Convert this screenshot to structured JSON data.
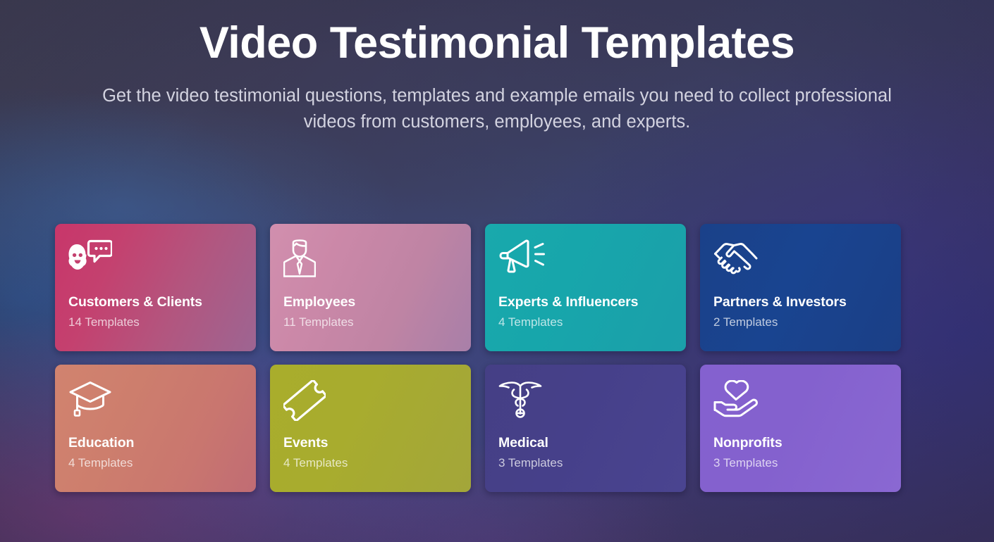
{
  "header": {
    "title": "Video Testimonial Templates",
    "subtitle": "Get the video testimonial questions, templates and example emails you need to collect professional videos from customers, employees, and experts."
  },
  "cards": [
    {
      "id": "customers-clients",
      "title": "Customers & Clients",
      "count": "14 Templates",
      "icon": "face-speech-bubble-icon",
      "gradient": "linear-gradient(115deg, #c8366a 0%, #c4416f 28%, #b2567f 62%, #9d6592 100%)",
      "color_start": "#c8366a",
      "color_end": "#9d6592"
    },
    {
      "id": "employees",
      "title": "Employees",
      "count": "11 Templates",
      "icon": "business-person-tie-icon",
      "gradient": "linear-gradient(115deg, #d18fae 0%, #cb88a8 30%, #bf84a4 65%, #a87fa8 100%)",
      "color_start": "#d18fae",
      "color_end": "#a87fa8"
    },
    {
      "id": "experts-influencers",
      "title": "Experts & Influencers",
      "count": "4 Templates",
      "icon": "megaphone-icon",
      "gradient": "linear-gradient(115deg, #19a9ac 0%, #17a6ab 40%, #1b9faa 100%)",
      "color_start": "#19a9ac",
      "color_end": "#1b9faa"
    },
    {
      "id": "partners-investors",
      "title": "Partners & Investors",
      "count": "2 Templates",
      "icon": "handshake-icon",
      "gradient": "linear-gradient(115deg, #1a4189 0%, #194490 45%, #1b3f86 100%)",
      "color_start": "#1a4189",
      "color_end": "#1b3f86"
    },
    {
      "id": "education",
      "title": "Education",
      "count": "4 Templates",
      "icon": "graduation-cap-icon",
      "gradient": "linear-gradient(115deg, #d1836f 0%, #cd7e6d 35%, #c9766f 70%, #c06c74 100%)",
      "color_start": "#d1836f",
      "color_end": "#c06c74"
    },
    {
      "id": "events",
      "title": "Events",
      "count": "4 Templates",
      "icon": "ticket-icon",
      "gradient": "linear-gradient(115deg, #a9ad2c 0%, #a8ac2e 40%, #a3a63a 100%)",
      "color_start": "#a9ad2c",
      "color_end": "#a3a63a"
    },
    {
      "id": "medical",
      "title": "Medical",
      "count": "3 Templates",
      "icon": "caduceus-icon",
      "gradient": "linear-gradient(115deg, #453f85 0%, #46408a 45%, #4a4490 100%)",
      "color_start": "#453f85",
      "color_end": "#4a4490"
    },
    {
      "id": "nonprofits",
      "title": "Nonprofits",
      "count": "3 Templates",
      "icon": "hand-heart-icon",
      "gradient": "linear-gradient(115deg, #8461cf 0%, #8461ce 45%, #8a68d2 100%)",
      "color_start": "#8461cf",
      "color_end": "#8a68d2"
    }
  ]
}
